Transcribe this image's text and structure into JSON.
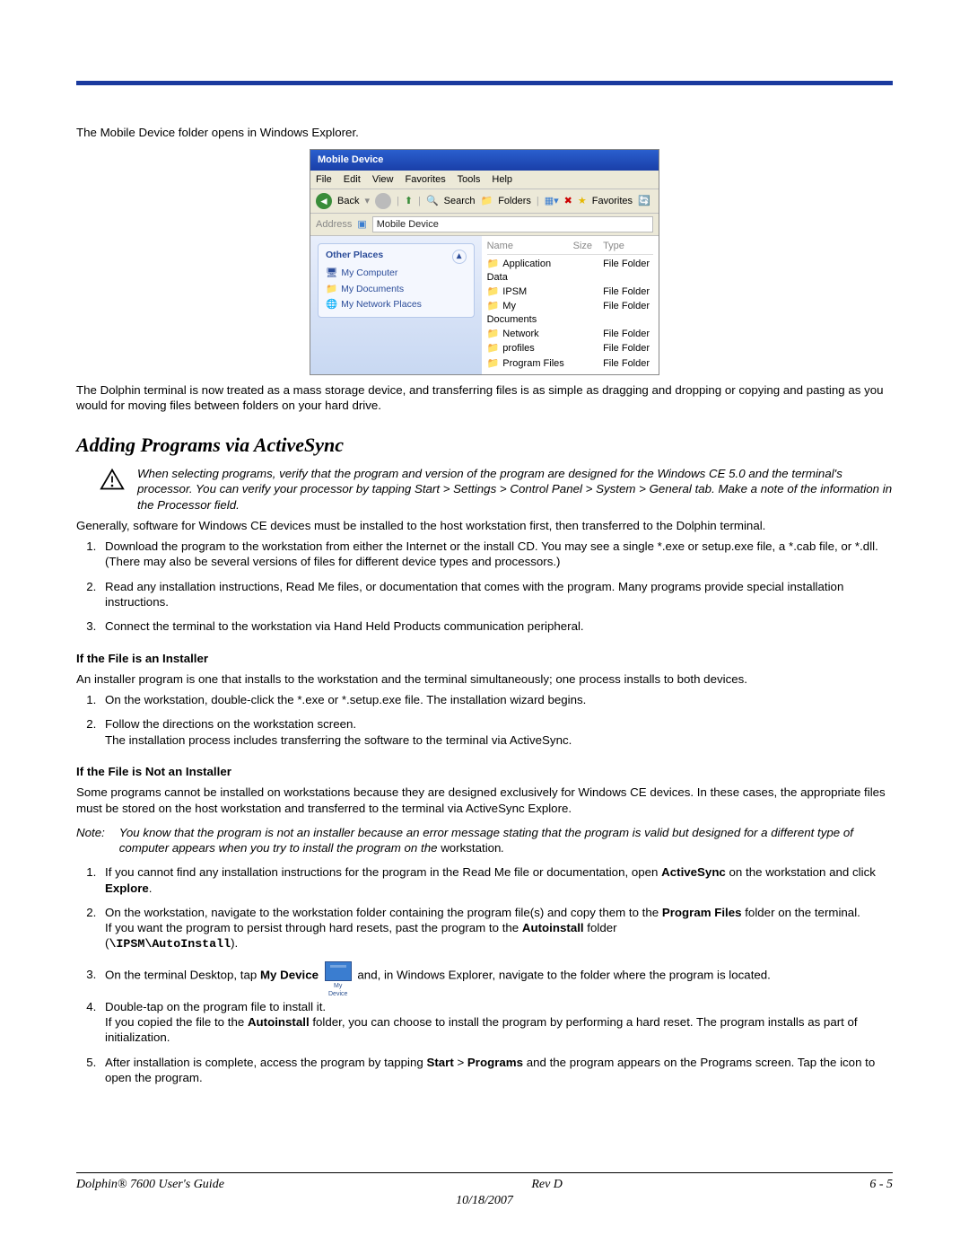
{
  "intro_para": "The Mobile Device folder opens in Windows Explorer.",
  "screenshot": {
    "title": "Mobile Device",
    "menu": [
      "File",
      "Edit",
      "View",
      "Favorites",
      "Tools",
      "Help"
    ],
    "toolbar": {
      "back": "Back",
      "search": "Search",
      "folders": "Folders",
      "favorites": "Favorites"
    },
    "address_label": "Address",
    "address_value": "Mobile Device",
    "side": {
      "header": "Other Places",
      "items": [
        "My Computer",
        "My Documents",
        "My Network Places"
      ]
    },
    "columns": {
      "name": "Name",
      "size": "Size",
      "type": "Type"
    },
    "rows": [
      {
        "name": "Application Data",
        "size": "",
        "type": "File Folder"
      },
      {
        "name": "IPSM",
        "size": "",
        "type": "File Folder"
      },
      {
        "name": "My Documents",
        "size": "",
        "type": "File Folder"
      },
      {
        "name": "Network",
        "size": "",
        "type": "File Folder"
      },
      {
        "name": "profiles",
        "size": "",
        "type": "File Folder"
      },
      {
        "name": "Program Files",
        "size": "",
        "type": "File Folder"
      }
    ]
  },
  "after_ss": "The Dolphin terminal is now treated as a mass storage device, and transferring files is as simple as dragging and dropping or copying and pasting as you would for moving files between folders on your hard drive.",
  "heading": "Adding Programs via ActiveSync",
  "warning": "When selecting programs, verify that the program and version of the program are designed for the Windows CE 5.0 and the terminal's processor. You can verify your processor by tapping Start > Settings > Control Panel > System > General tab. Make a note of the information in the Processor field.",
  "generally": "Generally, software for Windows CE devices must be installed to the host workstation first, then transferred to the Dolphin terminal.",
  "steps_a": [
    "Download the program to the workstation from either the Internet or the install CD. You may see a single *.exe or setup.exe file, a *.cab file, or *.dll. (There may also be several versions of files for different device types and processors.)",
    "Read any installation instructions, Read Me files, or documentation that comes with the program. Many programs provide special installation instructions.",
    "Connect the terminal to the workstation via Hand Held Products communication peripheral."
  ],
  "sub1": "If the File is an Installer",
  "sub1_text": "An installer program is one that installs to the workstation and the terminal simultaneously; one process installs to both devices.",
  "steps_b": [
    {
      "t": "On the workstation, double-click the *.exe or *.setup.exe file. The installation wizard begins."
    },
    {
      "t": "Follow the directions on the workstation screen.",
      "t2": "The installation process includes transferring the software to the terminal via ActiveSync."
    }
  ],
  "sub2": "If the File is Not an Installer",
  "sub2_text": "Some programs cannot be installed on workstations because they are designed exclusively for Windows CE devices. In these cases, the appropriate files must be stored on the host workstation and transferred to the terminal via ActiveSync Explore.",
  "note_lbl": "Note:",
  "note_body_italic": "You know that the program is not an installer because an error message stating that the program is valid but designed for a different type of computer appears when you try to install the program on the ",
  "note_body_plain": "workstation",
  "note_body_end": ".",
  "steps_c": {
    "s1a": "If you cannot find any installation instructions for the program in the Read Me file or documentation, open ",
    "s1b": "ActiveSync",
    "s1c": " on the workstation and click ",
    "s1d": "Explore",
    "s1e": ".",
    "s2a": "On the workstation, navigate to the workstation folder containing the program file(s) and copy them to the ",
    "s2b": "Program Files",
    "s2c": " folder on the terminal.",
    "s2d": "If you want the program to persist through hard resets, past the program to the ",
    "s2e": "Autoinstall",
    "s2f": " folder",
    "s2g": "(",
    "s2h": "\\IPSM\\AutoInstall",
    "s2i": ").",
    "s3a": "On the terminal Desktop, tap ",
    "s3b": "My Device",
    "s3c": " and, in Windows Explorer, navigate to the folder where the program is located.",
    "s4a": "Double-tap on the program file to install it.",
    "s4b": "If you copied the file to the ",
    "s4c": "Autoinstall",
    "s4d": " folder, you can choose to install the program by performing a hard reset. The program installs as part of initialization.",
    "s5a": "After installation is complete, access the program by tapping ",
    "s5b": "Start",
    "s5c": " > ",
    "s5d": "Programs",
    "s5e": " and the program appears on the Programs screen. Tap the icon to open the program."
  },
  "mydevice_label": "My Device",
  "footer": {
    "left": "Dolphin® 7600 User's Guide",
    "center": "Rev D",
    "date": "10/18/2007",
    "right": "6 - 5"
  }
}
